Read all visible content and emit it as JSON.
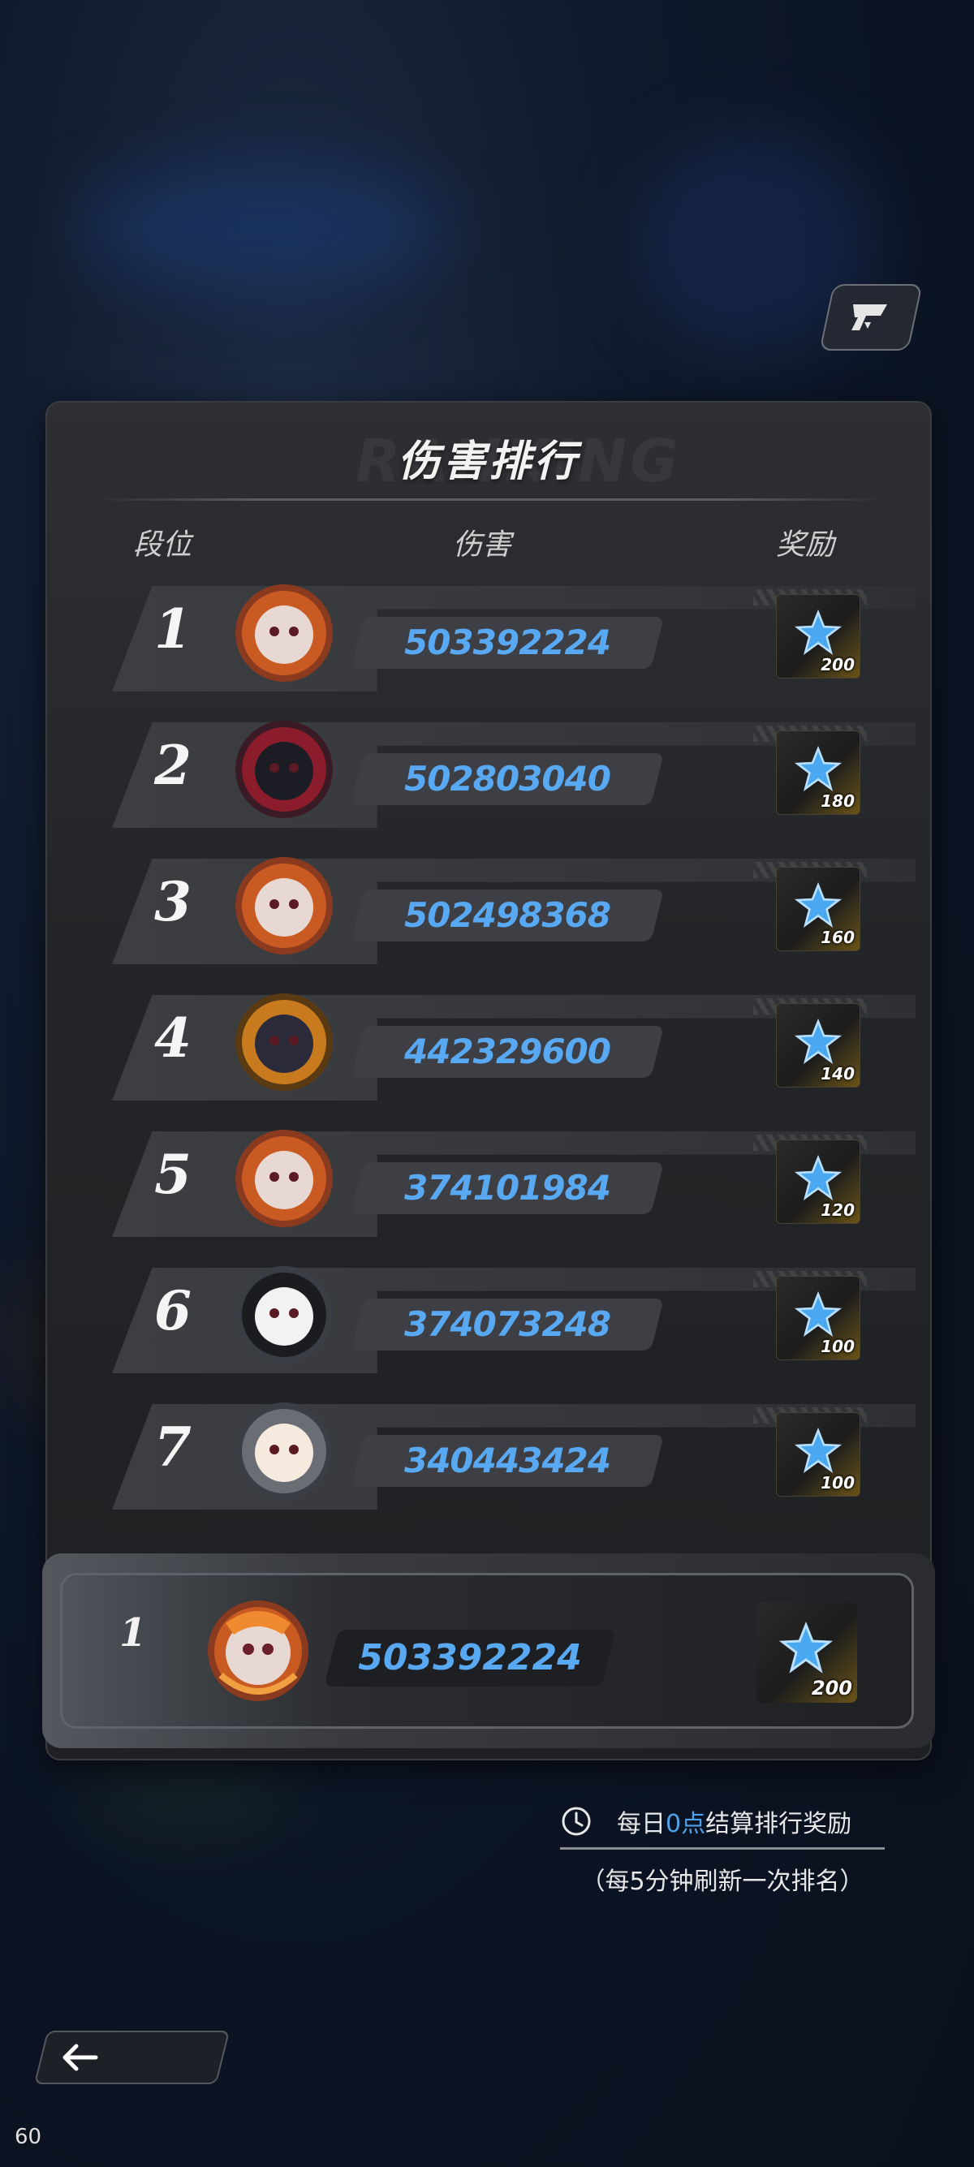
{
  "panel": {
    "title": "伤害排行",
    "title_watermark": "RANKING",
    "headers": {
      "tier": "段位",
      "damage": "伤害",
      "reward": "奖励"
    }
  },
  "rows": [
    {
      "rank": "1",
      "damage": "503392224",
      "reward": "200"
    },
    {
      "rank": "2",
      "damage": "502803040",
      "reward": "180"
    },
    {
      "rank": "3",
      "damage": "502498368",
      "reward": "160"
    },
    {
      "rank": "4",
      "damage": "442329600",
      "reward": "140"
    },
    {
      "rank": "5",
      "damage": "374101984",
      "reward": "120"
    },
    {
      "rank": "6",
      "damage": "374073248",
      "reward": "100"
    },
    {
      "rank": "7",
      "damage": "340443424",
      "reward": "100"
    }
  ],
  "my_rank": {
    "rank": "1",
    "damage": "503392224",
    "reward": "200"
  },
  "footnote": {
    "prefix": "每日",
    "highlight": "0点",
    "suffix": "结算排行奖励",
    "refresh": "（每5分钟刷新一次排名）"
  },
  "fps": "60",
  "icons": {
    "reward": "blue-star-icon",
    "refresh": "clock-icon",
    "back": "back-arrow-icon",
    "top_button": "flag-icon"
  },
  "colors": {
    "damage": "#58a8f2",
    "highlight": "#4ea2ea",
    "panel": "#26282b"
  }
}
